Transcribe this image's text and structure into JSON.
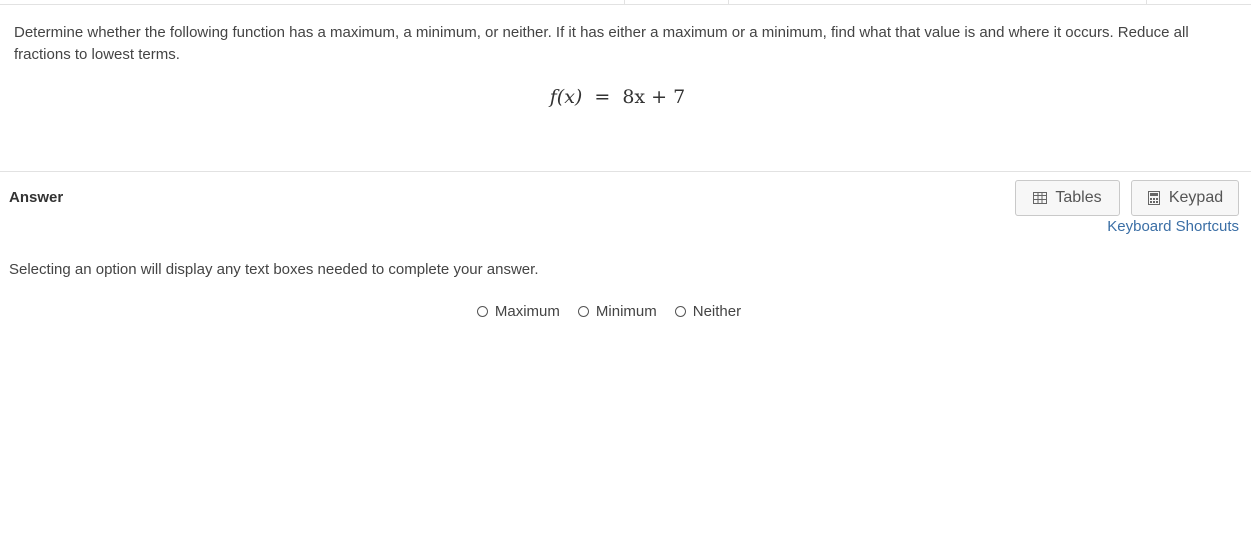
{
  "question": {
    "text": "Determine whether the following function has a maximum, a minimum, or neither. If it has either a maximum or a minimum, find what that value is and where it occurs. Reduce all fractions to lowest terms.",
    "formula_lhs": "f(x)",
    "formula_equals": "=",
    "formula_rhs": "8x + 7"
  },
  "answer": {
    "label": "Answer",
    "instructions": "Selecting an option will display any text boxes needed to complete your answer.",
    "options": [
      {
        "label": "Maximum"
      },
      {
        "label": "Minimum"
      },
      {
        "label": "Neither"
      }
    ]
  },
  "tools": {
    "tables_label": "Tables",
    "keypad_label": "Keypad",
    "shortcuts_label": "Keyboard Shortcuts",
    "tables_icon": "table-icon",
    "keypad_icon": "calculator-icon"
  },
  "colors": {
    "link": "#3a6ea5",
    "divider": "#e2e2e2",
    "button_bg": "#f7f7f7"
  }
}
